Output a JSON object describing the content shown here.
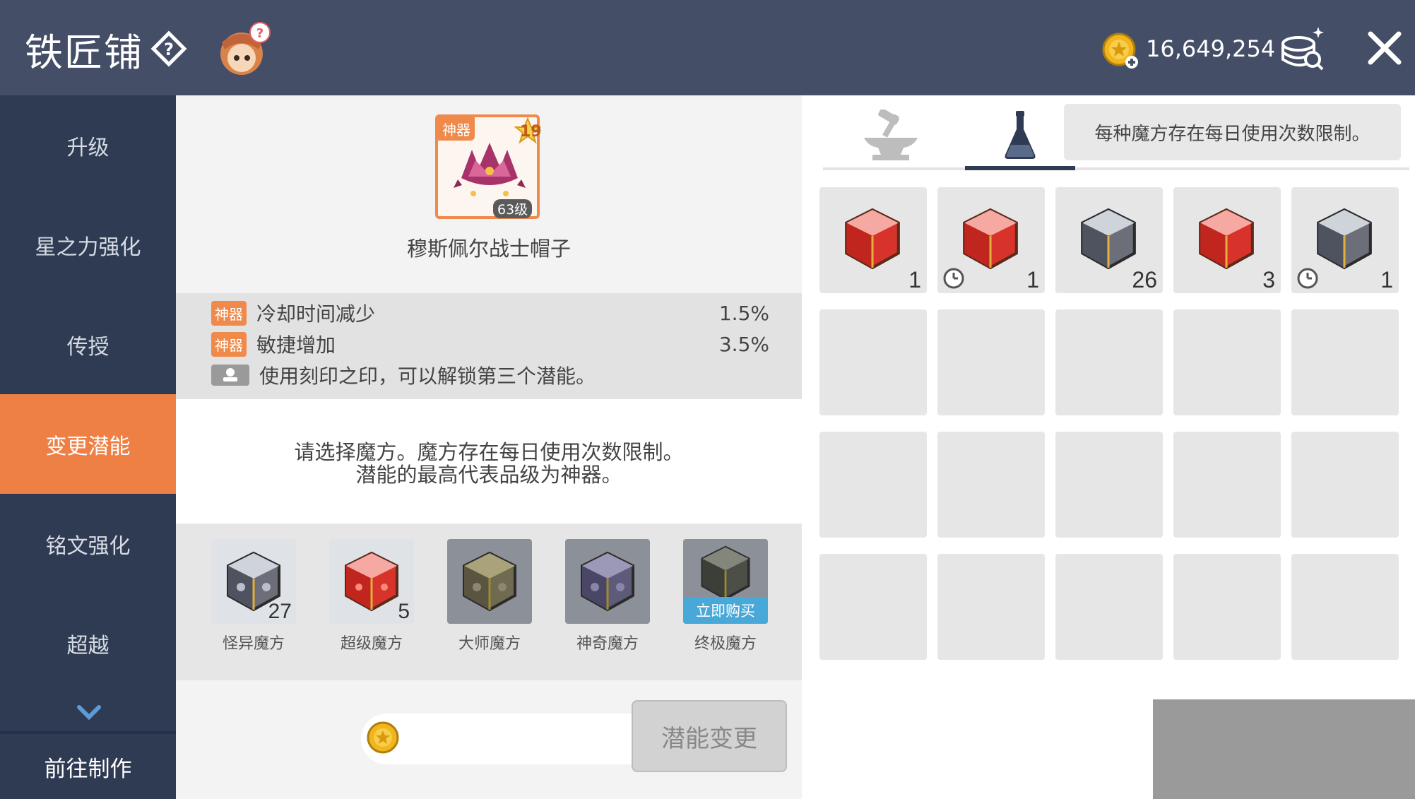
{
  "header": {
    "title": "铁匠铺",
    "coins": "16,649,254"
  },
  "sidebar": {
    "items": [
      {
        "label": "升级",
        "active": false
      },
      {
        "label": "星之力强化",
        "active": false
      },
      {
        "label": "传授",
        "active": false
      },
      {
        "label": "变更潜能",
        "active": true
      },
      {
        "label": "铭文强化",
        "active": false
      },
      {
        "label": "超越",
        "active": false
      }
    ],
    "bottom_label": "前往制作"
  },
  "item": {
    "grade_tag": "神器",
    "stars": "19",
    "level": "63级",
    "name": "穆斯佩尔战士帽子"
  },
  "potentials": [
    {
      "tag": "神器",
      "label": "冷却时间减少",
      "value": "1.5%"
    },
    {
      "tag": "神器",
      "label": "敏捷增加",
      "value": "3.5%"
    }
  ],
  "locked_hint": "使用刻印之印，可以解锁第三个潜能。",
  "message": {
    "line1": "请选择魔方。魔方存在每日使用次数限制。",
    "line2": "潜能的最高代表品级为神器。"
  },
  "cubes": [
    {
      "label": "怪异魔方",
      "count": "27",
      "color": "grey",
      "dim": false
    },
    {
      "label": "超级魔方",
      "count": "5",
      "color": "red",
      "dim": false
    },
    {
      "label": "大师魔方",
      "count": "",
      "color": "gold",
      "dim": true
    },
    {
      "label": "神奇魔方",
      "count": "",
      "color": "purple",
      "dim": true
    },
    {
      "label": "终极魔方",
      "count": "",
      "color": "dark",
      "dim": true,
      "buy_label": "立即购买"
    }
  ],
  "action_button": "潜能变更",
  "notice": "每种魔方存在每日使用次数限制。",
  "inventory": [
    {
      "color": "red",
      "count": "1",
      "timed": false
    },
    {
      "color": "red",
      "count": "1",
      "timed": true
    },
    {
      "color": "grey",
      "count": "26",
      "timed": false
    },
    {
      "color": "red",
      "count": "3",
      "timed": false
    },
    {
      "color": "grey",
      "count": "1",
      "timed": true
    }
  ],
  "colors": {
    "header_bg": "#444e66",
    "sidebar_bg": "#2f3b52",
    "accent": "#ee7f45",
    "buy_blue": "#48a8d8"
  }
}
